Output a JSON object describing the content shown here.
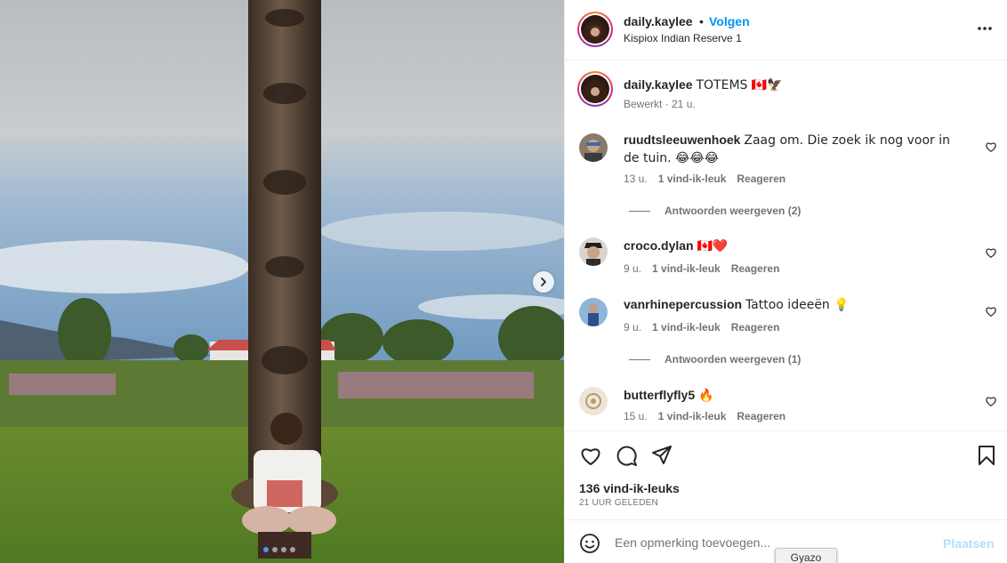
{
  "post": {
    "username": "daily.kaylee",
    "bullet": "•",
    "follow_label": "Volgen",
    "location": "Kispiox Indian Reserve 1",
    "caption_text": "TOTEMS 🇨🇦🦅",
    "caption_meta": "Bewerkt · 21 u.",
    "carousel": {
      "total_slides": 4,
      "active_slide": 1
    }
  },
  "comments": [
    {
      "username": "ruudtsleeuwenhoek",
      "text": "Zaag om. Die zoek ik nog voor in de tuin. 😂😂😂",
      "time": "13 u.",
      "likes": "1 vind-ik-leuk",
      "reply_label": "Reageren",
      "replies_label": "Antwoorden weergeven (2)"
    },
    {
      "username": "croco.dylan",
      "text": "🇨🇦❤️",
      "time": "9 u.",
      "likes": "1 vind-ik-leuk",
      "reply_label": "Reageren",
      "replies_label": ""
    },
    {
      "username": "vanrhinepercussion",
      "text": "Tattoo ideeën 💡",
      "time": "9 u.",
      "likes": "1 vind-ik-leuk",
      "reply_label": "Reageren",
      "replies_label": "Antwoorden weergeven (1)"
    },
    {
      "username": "butterflyfly5",
      "text": "🔥",
      "time": "15 u.",
      "likes": "1 vind-ik-leuk",
      "reply_label": "Reageren",
      "replies_label": ""
    }
  ],
  "actions": {
    "icons": [
      "heart-icon",
      "comment-icon",
      "share-icon",
      "bookmark-icon"
    ],
    "likes_count": "136 vind-ik-leuks",
    "date": "21 UUR GELEDEN"
  },
  "add_comment": {
    "placeholder": "Een opmerking toevoegen...",
    "post_label": "Plaatsen"
  },
  "tooltip": "Gyazo",
  "colors": {
    "accent": "#0095f6",
    "muted": "#737373",
    "post_disabled": "#b2dffc"
  }
}
